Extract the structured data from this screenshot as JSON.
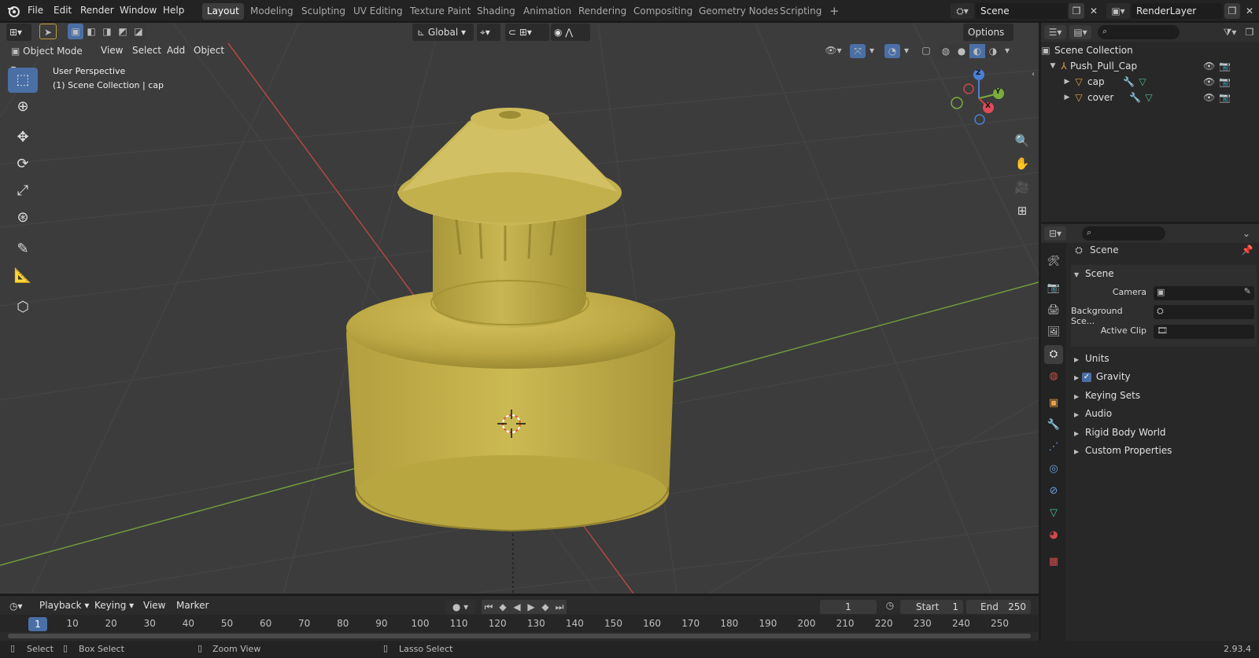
{
  "menu": {
    "items": [
      "File",
      "Edit",
      "Render",
      "Window",
      "Help"
    ]
  },
  "workspaces": {
    "tabs": [
      "Layout",
      "Modeling",
      "Sculpting",
      "UV Editing",
      "Texture Paint",
      "Shading",
      "Animation",
      "Rendering",
      "Compositing",
      "Geometry Nodes",
      "Scripting"
    ],
    "active": "Layout",
    "add_symbol": "+"
  },
  "scene_selector": {
    "value": "Scene"
  },
  "view_layer": {
    "value": "RenderLayer"
  },
  "viewport_header": {
    "mode": "Object Mode",
    "menus": [
      "View",
      "Select",
      "Add",
      "Object"
    ],
    "transform_orientation": "Global",
    "options": "Options"
  },
  "viewport_overlay": {
    "perspective": "User Perspective",
    "collection_info": "(1) Scene Collection | cap"
  },
  "gizmo": {
    "x": "X",
    "y": "Y",
    "z": "Z"
  },
  "colors": {
    "accent": "#4a6fa5",
    "object": "#c8b451",
    "x_axis": "#c84848",
    "y_axis": "#7cac3c",
    "z_axis": "#4a7fd6"
  },
  "outliner": {
    "root": "Scene Collection",
    "collection": "Push_Pull_Cap",
    "objects": [
      "cap",
      "cover"
    ]
  },
  "properties": {
    "context": "Scene",
    "panel_title": "Scene",
    "fields": [
      {
        "label": "Camera",
        "value": ""
      },
      {
        "label": "Background Sce...",
        "value": ""
      },
      {
        "label": "Active Clip",
        "value": ""
      }
    ],
    "subpanels": [
      "Units",
      "Gravity",
      "Keying Sets",
      "Audio",
      "Rigid Body World",
      "Custom Properties"
    ],
    "gravity_checked": true
  },
  "timeline": {
    "menus": [
      "Playback",
      "Keying",
      "View",
      "Marker"
    ],
    "current_frame": "1",
    "start_label": "Start",
    "start": "1",
    "end_label": "End",
    "end": "250",
    "ticks": [
      "1",
      "10",
      "20",
      "30",
      "40",
      "50",
      "60",
      "70",
      "80",
      "90",
      "100",
      "110",
      "120",
      "130",
      "140",
      "150",
      "160",
      "170",
      "180",
      "190",
      "200",
      "210",
      "220",
      "230",
      "240",
      "250"
    ]
  },
  "status_bar": {
    "select": "Select",
    "box_select": "Box Select",
    "zoom_view": "Zoom View",
    "lasso_select": "Lasso Select",
    "version": "2.93.4"
  }
}
